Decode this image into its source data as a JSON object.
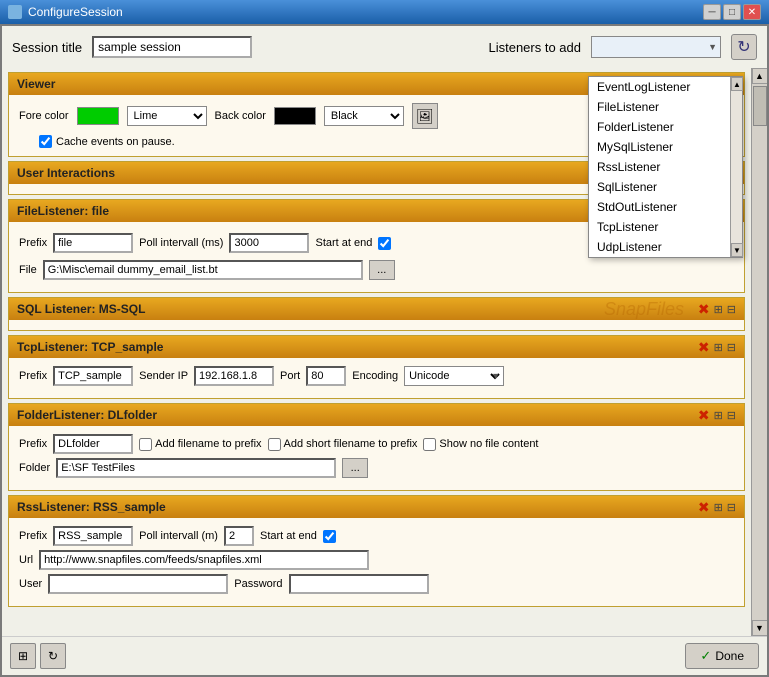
{
  "titlebar": {
    "title": "ConfigureSession",
    "min_btn": "─",
    "max_btn": "□",
    "close_btn": "✕"
  },
  "header": {
    "session_label": "Session title",
    "session_value": "sample session",
    "listeners_label": "Listeners to add",
    "refresh_icon": "↻"
  },
  "dropdown": {
    "items": [
      "EventLogListener",
      "FileListener",
      "FolderListener",
      "MySqlListener",
      "RssListener",
      "SqlListener",
      "StdOutListener",
      "TcpListener",
      "UdpListener"
    ]
  },
  "viewer": {
    "section_title": "Viewer",
    "fore_label": "Fore color",
    "fore_color": "#00cc00",
    "fore_combo": "Lime",
    "back_label": "Back color",
    "back_color": "#000000",
    "back_combo": "Black",
    "cache_label": "Cache events on pause."
  },
  "user_interactions": {
    "section_title": "User Interactions"
  },
  "file_listener": {
    "section_title": "FileListener: file",
    "prefix_label": "Prefix",
    "prefix_value": "file",
    "poll_label": "Poll intervall (ms)",
    "poll_value": "3000",
    "start_label": "Start at end",
    "file_label": "File",
    "file_path": "G:\\Misc\\email dummy_email_list.bt",
    "browse_btn": "..."
  },
  "sql_listener": {
    "section_title": "SQL Listener: MS-SQL",
    "watermark": "SnapFiles"
  },
  "tcp_listener": {
    "section_title": "TcpListener: TCP_sample",
    "prefix_label": "Prefix",
    "prefix_value": "TCP_sample",
    "sender_label": "Sender IP",
    "sender_value": "192.168.1.8",
    "port_label": "Port",
    "port_value": "80",
    "encoding_label": "Encoding",
    "encoding_value": "Unicode"
  },
  "folder_listener": {
    "section_title": "FolderListener: DLfolder",
    "prefix_label": "Prefix",
    "prefix_value": "DLfolder",
    "add_filename_label": "Add filename to prefix",
    "add_short_label": "Add short filename to prefix",
    "show_no_file_label": "Show no file content",
    "folder_label": "Folder",
    "folder_value": "E:\\SF TestFiles",
    "browse_btn": "..."
  },
  "rss_listener": {
    "section_title": "RssListener: RSS_sample",
    "prefix_label": "Prefix",
    "prefix_value": "RSS_sample",
    "poll_label": "Poll intervall (m)",
    "poll_value": "2",
    "start_label": "Start at end",
    "url_label": "Url",
    "url_value": "http://www.snapfiles.com/feeds/snapfiles.xml",
    "user_label": "User",
    "user_value": "",
    "password_label": "Password",
    "password_value": ""
  },
  "bottom": {
    "done_label": "Done",
    "check_icon": "✓"
  }
}
